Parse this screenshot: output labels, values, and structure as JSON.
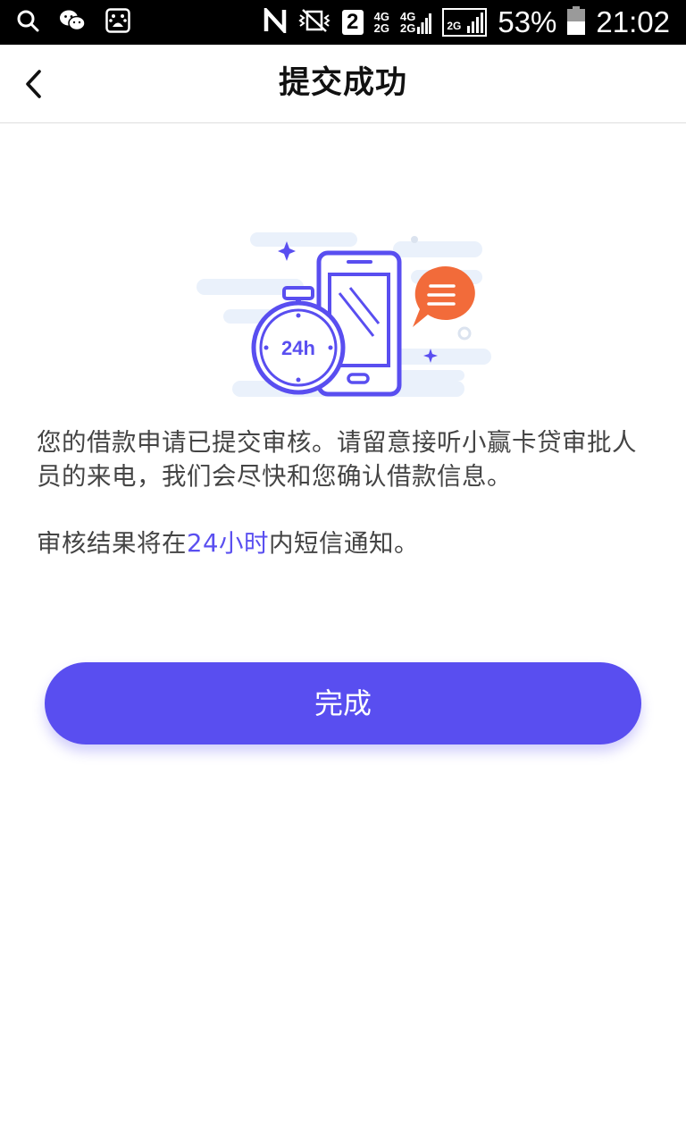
{
  "status_bar": {
    "net_top": "4G",
    "net_bottom": "2G",
    "net2_top": "4G",
    "net2_bottom": "2G",
    "sim_slot": "2",
    "sig3_label": "2G",
    "battery": "53%",
    "time": "21:02",
    "icons": [
      "search-icon",
      "wechat-icon",
      "baidu-icon",
      "nfc-icon",
      "vibrate-icon"
    ]
  },
  "nav": {
    "title": "提交成功",
    "back_icon": "chevron-left-icon"
  },
  "illustration": {
    "clock_label": "24h"
  },
  "content": {
    "message": "您的借款申请已提交审核。请留意接听小赢卡贷审批人员的来电，我们会尽快和您确认借款信息。",
    "notice_prefix": "审核结果将在",
    "notice_highlight": "24小时",
    "notice_suffix": "内短信通知。"
  },
  "actions": {
    "done_label": "完成"
  },
  "colors": {
    "accent": "#594ef0",
    "bubble": "#f26b3a",
    "status_bar_bg": "#000000"
  }
}
